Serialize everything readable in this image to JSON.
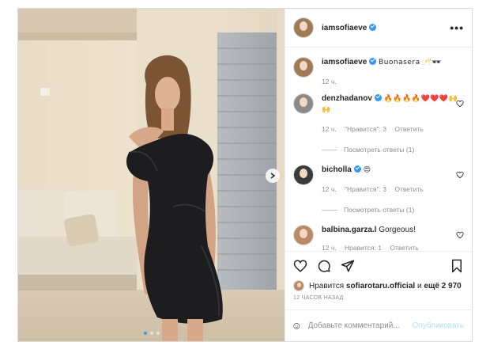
{
  "post": {
    "author": "iamsofiaeve",
    "caption": "Buonasera 🥂🕶",
    "caption_time": "12 ч.",
    "more_icon": "more-options-icon"
  },
  "comments": [
    {
      "user": "denzhadanov",
      "verified": true,
      "text": "🔥🔥🔥🔥❤️❤️❤️🙌🙌",
      "time": "12 ч.",
      "likes": "\"Нравится\": 3",
      "reply": "Ответить",
      "view_replies": "Посмотреть ответы (1)"
    },
    {
      "user": "bicholla",
      "verified": true,
      "text": "😍",
      "time": "12 ч.",
      "likes": "\"Нравится\": 3",
      "reply": "Ответить",
      "view_replies": "Посмотреть ответы (1)"
    },
    {
      "user": "balbina.garza.l",
      "verified": false,
      "text": "Gorgeous!",
      "time": "12 ч.",
      "likes": "Нравится: 1",
      "reply": "Ответить"
    }
  ],
  "likes": {
    "prefix": "Нравится",
    "user": "sofiarotaru.official",
    "middle": "и",
    "others": "ещё 2 970"
  },
  "time_ago": "12 ЧАСОВ НАЗАД",
  "add_comment": {
    "placeholder": "Добавьте комментарий...",
    "publish_label": "Опубликовать"
  },
  "carousel": {
    "current_slide": 1,
    "total_slides": 3
  },
  "colors": {
    "accent": "#3897f0",
    "publish_disabled": "#b2dffc",
    "heart_red": "#ed4956"
  }
}
